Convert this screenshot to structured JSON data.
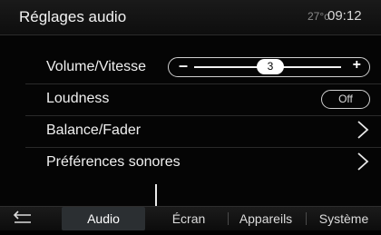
{
  "header": {
    "title": "Réglages audio",
    "temperature": "27°c",
    "time": "09:12"
  },
  "settings": {
    "volume": {
      "label": "Volume/Vitesse",
      "value": "3",
      "minus": "–",
      "plus": "+"
    },
    "loudness": {
      "label": "Loudness",
      "state": "Off"
    },
    "balance": {
      "label": "Balance/Fader"
    },
    "preferences": {
      "label": "Préférences sonores"
    }
  },
  "tabs": {
    "back_icon": "back-arrow-icon",
    "items": [
      {
        "label": "Audio",
        "active": true
      },
      {
        "label": "Écran",
        "active": false
      },
      {
        "label": "Appareils",
        "active": false
      },
      {
        "label": "Système",
        "active": false
      }
    ]
  },
  "colors": {
    "background": "#050505",
    "text": "#f0f0f0",
    "active_tab": "#2b2f32"
  }
}
